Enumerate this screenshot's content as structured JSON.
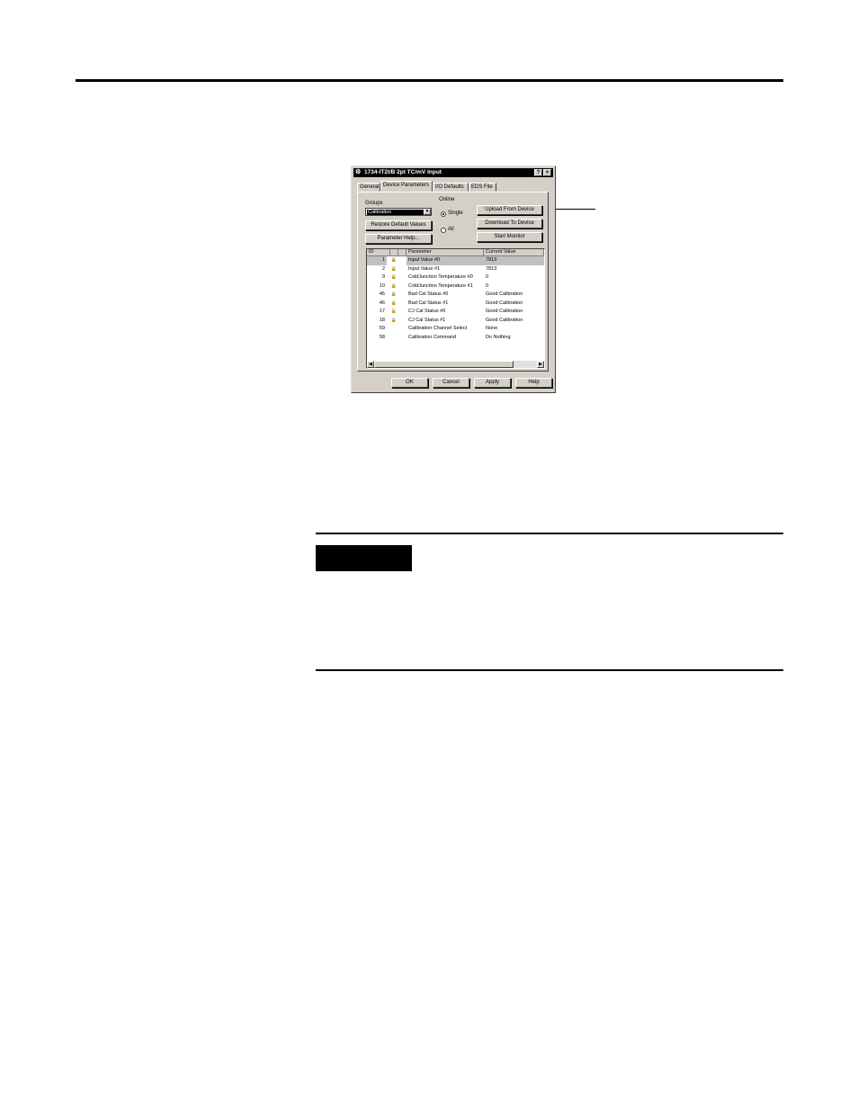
{
  "dialog": {
    "title": "1734-IT2I/B 2pt TC/mV Input",
    "help_btn": "?",
    "close_btn": "×",
    "tabs": [
      "General",
      "Device Parameters",
      "I/O Defaults",
      "EDS File"
    ],
    "active_tab": "Device Parameters",
    "groups_label": "Groups",
    "groups_value": "Calibration",
    "online_label": "Online",
    "radio_single": "Single",
    "radio_all": "All",
    "buttons": {
      "restore": "Restore Default Values",
      "param_help": "Parameter Help...",
      "upload": "Upload From Device",
      "download": "Download To Device",
      "monitor": "Start Monitor",
      "ok": "OK",
      "cancel": "Cancel",
      "apply": "Apply",
      "help": "Help"
    },
    "table": {
      "headers": [
        "ID",
        "Parameter",
        "Current Value"
      ],
      "rows": [
        {
          "id": "1",
          "param": "Input Value #0",
          "value": "7813",
          "lock": true
        },
        {
          "id": "2",
          "param": "Input Value #1",
          "value": "7813",
          "lock": true
        },
        {
          "id": "9",
          "param": "ColdJunction Temperature #0",
          "value": "0",
          "lock": true
        },
        {
          "id": "10",
          "param": "ColdJunction Temperature #1",
          "value": "0",
          "lock": true
        },
        {
          "id": "45",
          "param": "Bad Cal Status #0",
          "value": "Good Calibration",
          "lock": true
        },
        {
          "id": "46",
          "param": "Bad Cal Status #1",
          "value": "Good Calibration",
          "lock": true
        },
        {
          "id": "17",
          "param": "CJ Cal Status #0",
          "value": "Good Calibration",
          "lock": true
        },
        {
          "id": "18",
          "param": "CJ Cal Status #1",
          "value": "Good Calibration",
          "lock": true
        },
        {
          "id": "59",
          "param": "Calibration Channel Select",
          "value": "None",
          "lock": false
        },
        {
          "id": "58",
          "param": "Calibration Command",
          "value": "Do Nothing",
          "lock": false
        }
      ]
    }
  }
}
